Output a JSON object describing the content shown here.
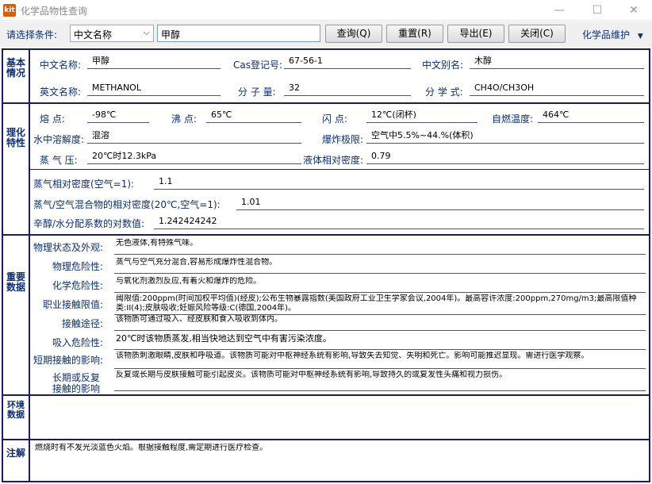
{
  "window": {
    "icon_text": "kit",
    "title": "化学品物性查询",
    "minimize": "—",
    "maximize": "☐",
    "close": "✕"
  },
  "toolbar": {
    "condition_label": "请选择条件:",
    "condition_selected": "中文名称",
    "search_value": "甲醇",
    "query_label": "查询(Q)",
    "reset_label": "重置(R)",
    "export_label": "导出(E)",
    "close_label": "关闭(C)",
    "maintenance_label": "化学品维护"
  },
  "sections": {
    "basic": "基本情况",
    "physchem": "理化特性",
    "important": "重要数据",
    "environment": "环境数据",
    "notes": "注解"
  },
  "basic": {
    "cn_name_label": "中文名称:",
    "cn_name": "甲醇",
    "cas_label": "Cas登记号:",
    "cas": "67-56-1",
    "alias_label": "中文别名:",
    "alias": "木醇",
    "en_name_label": "英文名称:",
    "en_name": "METHANOL",
    "mw_label": "分 子 量:",
    "mw": "32",
    "formula_label": "分 学 式:",
    "formula": "CH4O/CH3OH"
  },
  "physchem": {
    "melting_label": "熔    点:",
    "melting": "-98℃",
    "boiling_label": "沸  点:",
    "boiling": "65℃",
    "flash_label": "闪    点:",
    "flash": "12℃(闭杯)",
    "autoignition_label": "自燃温度:",
    "autoignition": "464℃",
    "solubility_label": "水中溶解度:",
    "solubility": "混溶",
    "explosion_label": "爆炸极限:",
    "explosion": "空气中5.5%~44.%(体积)",
    "vapor_pressure_label": "蒸 气 压:",
    "vapor_pressure": "20℃时12.3kPa",
    "liquid_density_label": "液体相对密度:",
    "liquid_density": "0.79",
    "vapor_density_label": "蒸气相对密度(空气=1):",
    "vapor_density": "1.1",
    "mixture_density_label": "蒸气/空气混合物的相对密度(20℃,空气=1):",
    "mixture_density": "1.01",
    "logp_label": "辛醇/水分配系数的对数值:",
    "logp": "1.242424242"
  },
  "important": {
    "state_label": "物理状态及外观:",
    "state": "无色液体,有特殊气味。",
    "phys_hazard_label": "物理危险性:",
    "phys_hazard": "蒸气与空气充分混合,容易形成爆炸性混合物。",
    "chem_hazard_label": "化学危险性:",
    "chem_hazard": "与氧化剂激烈反应,有着火和爆炸的危险。",
    "exposure_limit_label": "职业接触限值:",
    "exposure_limit": "阈限值:200ppm(时间加权平均值)(经皮);公布生物暴露指数(美国政府工业卫生学家会议,2004年)。最高容许浓度:200ppm,270mg/m3;最高限值种类:II(4);皮肤吸收;妊娠风险等级:C(德国,2004年)。",
    "route_label": "接触途径:",
    "route": "该物质可通过吸入、经皮肤和食入吸收到体内。",
    "inhalation_label": "吸入危险性:",
    "inhalation": "20℃时该物质蒸发,相当快地达到空气中有害污染浓度。",
    "short_term_label": "短期接触的影响:",
    "short_term": "该物质刺激眼睛,皮肤和呼吸道。该物质可能对中枢神经系统有影响,导致失去知觉、失明和死亡。影响可能推迟显现。需进行医学观察。",
    "long_term_label_1": "长期或反复",
    "long_term_label_2": "接触的影响",
    "long_term": "反复或长期与皮肤接触可能引起皮炎。该物质可能对中枢神经系统有影响,导致持久的或复发性头痛和视力损伤。"
  },
  "environment": {
    "text": ""
  },
  "notes": {
    "text": "燃烧时有不发光淡蓝色火焰。根据接触程度,需定期进行医疗检查。"
  }
}
